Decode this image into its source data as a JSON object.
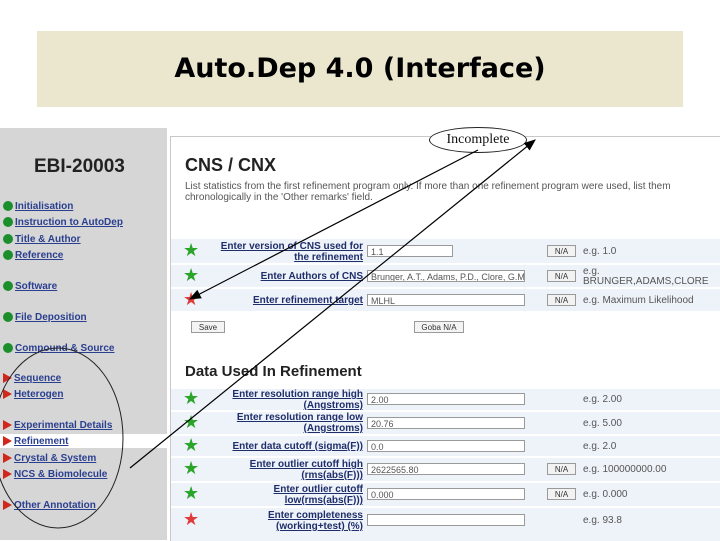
{
  "slide_title": "Auto.Dep 4.0 (Interface)",
  "callout": "Incomplete",
  "sidebar": {
    "id": "EBI-20003",
    "items": [
      {
        "label": "Initialisation",
        "icon": "green-dot"
      },
      {
        "label": "Instruction to AutoDep",
        "icon": "green-dot"
      },
      {
        "label": "Title & Author",
        "icon": "green-dot"
      },
      {
        "label": "Reference",
        "icon": "green-dot"
      },
      {
        "label": "Software",
        "icon": "green-dot"
      },
      {
        "label": "File Deposition",
        "icon": "green-dot"
      },
      {
        "label": "Compound & Source",
        "icon": "green-dot"
      },
      {
        "label": "Sequence",
        "icon": "red-triangle"
      },
      {
        "label": "Heterogen",
        "icon": "red-triangle"
      },
      {
        "label": "Experimental Details",
        "icon": "red-triangle"
      },
      {
        "label": "Refinement",
        "icon": "red-triangle"
      },
      {
        "label": "Crystal & System",
        "icon": "red-triangle"
      },
      {
        "label": "NCS & Biomolecule",
        "icon": "red-triangle"
      },
      {
        "label": "Other Annotation",
        "icon": "red-triangle"
      }
    ]
  },
  "cns": {
    "title": "CNS / CNX",
    "description": "List statistics from the first refinement program only. If more than one refinement program were used, list them chronologically in the 'Other remarks' field.",
    "rows": [
      {
        "label1": "Enter version of CNS used for",
        "label2": "the refinement",
        "value": "1.1",
        "na": "N/A",
        "eg1": "e.g. 1.0",
        "eg2": "",
        "star": "green"
      },
      {
        "label1": "Enter Authors of CNS",
        "label2": "",
        "value": "Brunger, A.T., Adams, P.D., Clore, G.M., Delano",
        "na": "N/A",
        "eg1": "e.g.",
        "eg2": "BRUNGER,ADAMS,CLORE",
        "star": "green"
      },
      {
        "label1": "Enter refinement target",
        "label2": "",
        "value": "MLHL",
        "na": "N/A",
        "eg1": "e.g. Maximum Likelihood",
        "eg2": "",
        "star": "red"
      }
    ],
    "save_label": "Save",
    "goba_label": "Goba N/A"
  },
  "data": {
    "title": "Data Used In Refinement",
    "rows": [
      {
        "label1": "Enter resolution range high",
        "label2": "(Angstroms)",
        "value": "2.00",
        "na": "",
        "eg": "e.g. 2.00",
        "star": "green"
      },
      {
        "label1": "Enter resolution range low",
        "label2": "(Angstroms)",
        "value": "20.76",
        "na": "",
        "eg": "e.g. 5.00",
        "star": "green"
      },
      {
        "label1": "Enter data cutoff (sigma(F))",
        "label2": "",
        "value": "0.0",
        "na": "",
        "eg": "e.g. 2.0",
        "star": "green"
      },
      {
        "label1": "Enter outlier cutoff high",
        "label2": "(rms(abs(F)))",
        "value": "2622565.80",
        "na": "N/A",
        "eg": "e.g. 100000000.00",
        "star": "green"
      },
      {
        "label1": "Enter outlier cutoff",
        "label2": "low(rms(abs(F)))",
        "value": "0.000",
        "na": "N/A",
        "eg": "e.g. 0.000",
        "star": "green"
      },
      {
        "label1": "Enter completeness",
        "label2": "(working+test) (%)",
        "value": "",
        "na": "",
        "eg": "e.g. 93.8",
        "star": "red"
      }
    ]
  },
  "colors": {
    "banner": "#ebe7cf",
    "sidebar": "#d6d6d6",
    "link": "#2a3f8f",
    "green": "#2aa52a",
    "red": "#e03b3b"
  }
}
